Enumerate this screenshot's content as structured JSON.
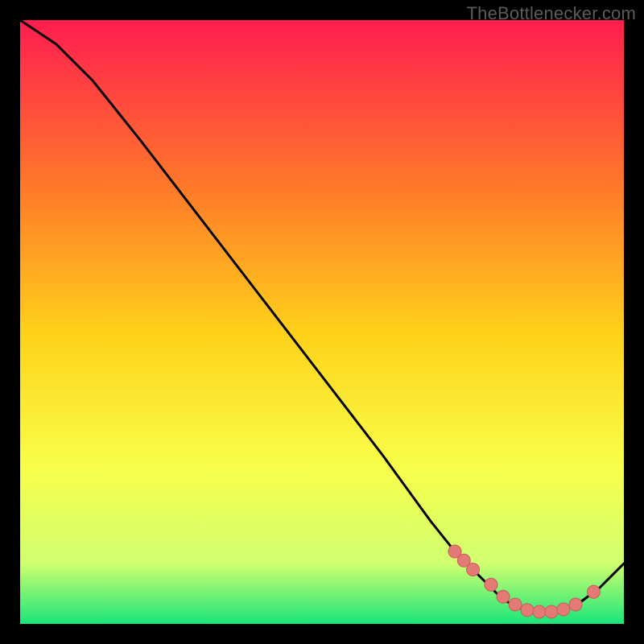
{
  "attribution": "TheBottlenecker.com",
  "colors": {
    "bg": "#000000",
    "grad_top": "#ff1d4f",
    "grad_mid_upper": "#ff7a2a",
    "grad_mid": "#ffd21a",
    "grad_mid_lower": "#f8ff4a",
    "grad_low": "#d0ff70",
    "grad_bottom": "#19e57a",
    "curve": "#000000",
    "marker_fill": "#e47a76",
    "marker_stroke": "#c95c58"
  },
  "chart_data": {
    "type": "line",
    "title": "",
    "xlabel": "",
    "ylabel": "",
    "xlim": [
      0,
      100
    ],
    "ylim": [
      0,
      100
    ],
    "series": [
      {
        "name": "bottleneck-curve",
        "x": [
          0,
          6,
          12,
          20,
          30,
          40,
          50,
          60,
          68,
          72,
          76,
          80,
          84,
          88,
          92,
          96,
          100
        ],
        "y": [
          100,
          96,
          90,
          80,
          67,
          54,
          41,
          28,
          17,
          12,
          8,
          4,
          2,
          2,
          3,
          6,
          10
        ]
      }
    ],
    "markers": {
      "name": "highlighted-range",
      "x": [
        72,
        73.5,
        75,
        78,
        80,
        82,
        84,
        86,
        88,
        90,
        92,
        95
      ],
      "y": [
        12,
        10.5,
        9,
        6.5,
        4.5,
        3.2,
        2.3,
        2.0,
        2.0,
        2.4,
        3.2,
        5.3
      ]
    }
  }
}
